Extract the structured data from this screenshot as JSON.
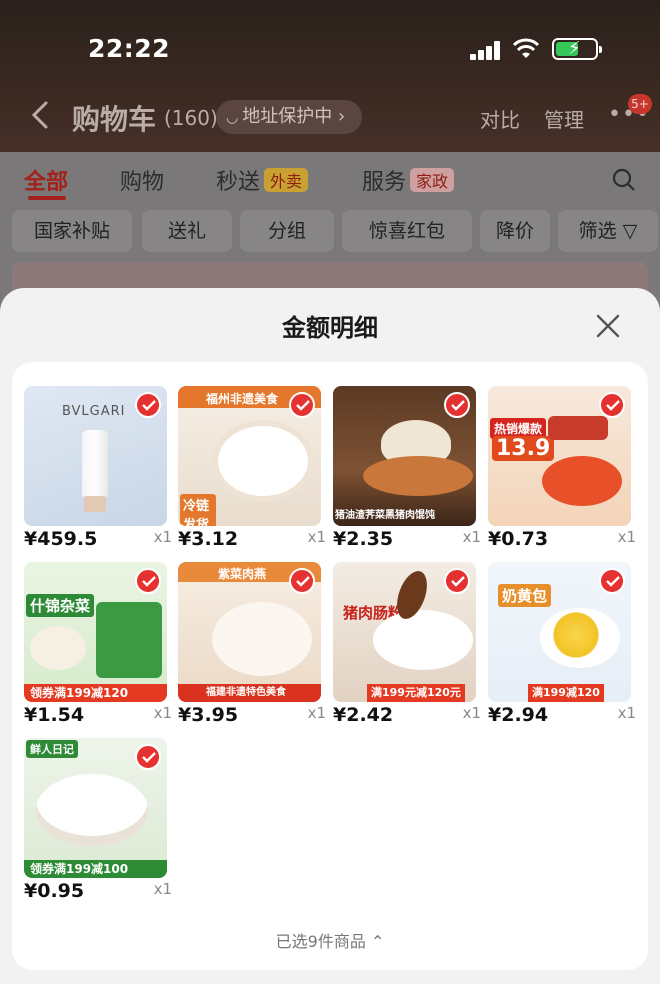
{
  "status_bar": {
    "time": "22:22"
  },
  "nav": {
    "title": "购物车",
    "count": "(160)",
    "address_protect": "地址保护中",
    "compare": "对比",
    "manage": "管理",
    "badge": "5+"
  },
  "tabs": [
    {
      "label": "全部",
      "tag": ""
    },
    {
      "label": "购物",
      "tag": ""
    },
    {
      "label": "秒送",
      "tag": "外卖"
    },
    {
      "label": "服务",
      "tag": "家政"
    }
  ],
  "chips": [
    "国家补贴",
    "送礼",
    "分组",
    "惊喜红包",
    "降价",
    "筛选"
  ],
  "sheet": {
    "title": "金额明细",
    "footer": "已选9件商品"
  },
  "items": [
    {
      "price": "¥459.5",
      "qty": "x1",
      "brand": "BVLGARI",
      "caption": ""
    },
    {
      "price": "¥3.12",
      "qty": "x1",
      "brand": "福州非遗美食",
      "caption": "冷链发货"
    },
    {
      "price": "¥2.35",
      "qty": "x1",
      "brand": "",
      "caption": "猪油渣荠菜黑猪肉馄饨"
    },
    {
      "price": "¥0.73",
      "qty": "x1",
      "brand": "热销爆款",
      "caption": "13.9"
    },
    {
      "price": "¥1.54",
      "qty": "x1",
      "brand": "什锦杂菜",
      "caption": "领券满199减120"
    },
    {
      "price": "¥3.95",
      "qty": "x1",
      "brand": "紫菜肉燕",
      "caption": "福建非遗特色美食"
    },
    {
      "price": "¥2.42",
      "qty": "x1",
      "brand": "猪肉肠粉",
      "caption": "满199元减120元"
    },
    {
      "price": "¥2.94",
      "qty": "x1",
      "brand": "奶黄包",
      "caption": "满199减120"
    },
    {
      "price": "¥0.95",
      "qty": "x1",
      "brand": "鲜人日记",
      "caption": "领券满199减100"
    }
  ],
  "colors": {
    "accent": "#e5312f",
    "sheet_bg": "#f2f2f2"
  }
}
